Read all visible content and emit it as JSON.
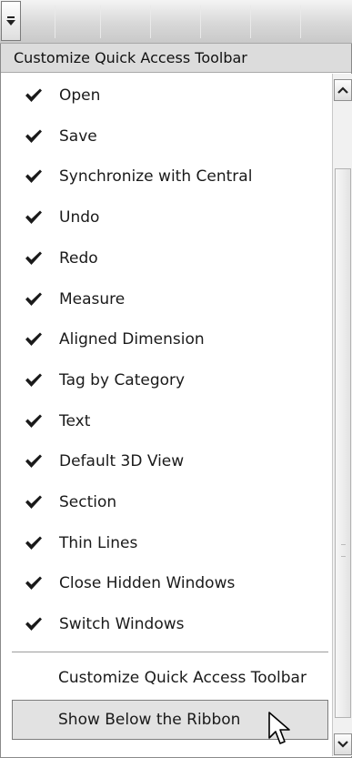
{
  "menu": {
    "title": "Customize Quick Access Toolbar",
    "items": [
      {
        "label": "Open",
        "checked": true
      },
      {
        "label": "Save",
        "checked": true
      },
      {
        "label": "Synchronize with Central",
        "checked": true
      },
      {
        "label": "Undo",
        "checked": true
      },
      {
        "label": "Redo",
        "checked": true
      },
      {
        "label": "Measure",
        "checked": true
      },
      {
        "label": "Aligned Dimension",
        "checked": true
      },
      {
        "label": "Tag by Category",
        "checked": true
      },
      {
        "label": "Text",
        "checked": true
      },
      {
        "label": "Default 3D View",
        "checked": true
      },
      {
        "label": "Section",
        "checked": true
      },
      {
        "label": "Thin Lines",
        "checked": true
      },
      {
        "label": "Close Hidden Windows",
        "checked": true
      },
      {
        "label": "Switch Windows",
        "checked": true
      }
    ],
    "actions": [
      {
        "label": "Customize Quick Access Toolbar"
      },
      {
        "label": "Show Below the Ribbon",
        "hovered": true
      }
    ]
  },
  "icons": {
    "dropdown": "dropdown-arrow-icon",
    "check": "checkmark-icon",
    "scroll_up": "scroll-up-arrow-icon",
    "scroll_down": "scroll-down-arrow-icon",
    "cursor": "mouse-pointer-icon"
  },
  "colors": {
    "menu_background": "#ffffff",
    "title_background": "#dcdcdc",
    "hover_background": "#e2e2e2",
    "border": "#8a8a8a"
  }
}
